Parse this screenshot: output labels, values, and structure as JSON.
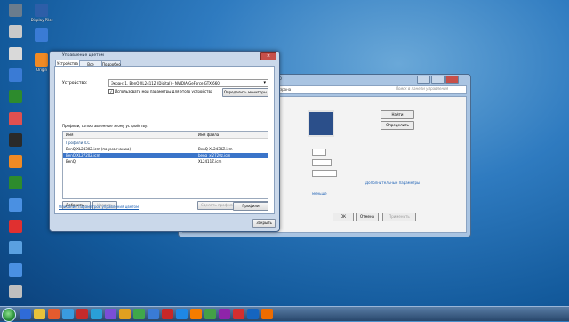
{
  "desktop": {
    "icons": [
      {
        "label": "",
        "color": "#6b7c8d"
      },
      {
        "label": "",
        "color": "#c9c9c9"
      },
      {
        "label": "",
        "color": "#d9d9d9"
      },
      {
        "label": "",
        "color": "#3a7bd5"
      },
      {
        "label": "",
        "color": "#2d8b2d"
      },
      {
        "label": "",
        "color": "#e05050"
      },
      {
        "label": "",
        "color": "#2a2a2a"
      },
      {
        "label": "",
        "color": "#f08a24"
      },
      {
        "label": "",
        "color": "#2d8b2d"
      },
      {
        "label": "",
        "color": "#4a90e2"
      },
      {
        "label": "",
        "color": "#e03030"
      },
      {
        "label": "",
        "color": "#5aa0e0"
      },
      {
        "label": "",
        "color": "#4a90e2"
      },
      {
        "label": "",
        "color": "#bfbfbf"
      }
    ],
    "top_icons": [
      {
        "label": "Display Pilot",
        "color": "#2d5ea8"
      },
      {
        "label": "",
        "color": "#3a7bd5"
      },
      {
        "label": "Origin",
        "color": "#f08a24"
      }
    ]
  },
  "back_window": {
    "title": "ТХ 660",
    "address": "зрана",
    "search_placeholder": "Поиск в панели управления",
    "buttons": {
      "find": "Найти",
      "identify": "Определить",
      "ok": "ОК",
      "cancel": "Отмена",
      "apply": "Применить"
    },
    "links": {
      "additional": "Дополнительные параметры",
      "smaller": "меньше"
    },
    "dropdowns": [
      "",
      "",
      ""
    ]
  },
  "color_mgmt": {
    "title": "Управление цветом",
    "tabs": [
      "Устройства",
      "Все профили",
      "Подробно"
    ],
    "device_label": "Устройство:",
    "device_value": "Экран: 1. BenQ XL2411Z (Digital) - NVIDIA GeForce GTX 660",
    "use_my_settings": "Использовать мои параметры для этого устройства",
    "identify_monitors": "Определить мониторы",
    "profiles_label": "Профили, сопоставленные этому устройству:",
    "columns": {
      "name": "Имя",
      "file": "Имя файла"
    },
    "group": "Профили ICC",
    "profiles": [
      {
        "name": "BenQ XL2430Z.icm (по умолчанию)",
        "file": "BenQ XL2430Z.icm",
        "selected": false
      },
      {
        "name": "BenQ XL2720Z.icm",
        "file": "benq_xl2720z.icm",
        "selected": true
      },
      {
        "name": "BenQ",
        "file": "XL2411Z.icm",
        "selected": false
      }
    ],
    "add": "Добавить...",
    "remove": "Удалить",
    "set_default": "Сделать профилем по умолчанию",
    "link": "Описание параметров управления цветом",
    "profiles_btn": "Профили",
    "close": "Закрыть"
  },
  "taskbar": {
    "time": "",
    "date": ""
  }
}
